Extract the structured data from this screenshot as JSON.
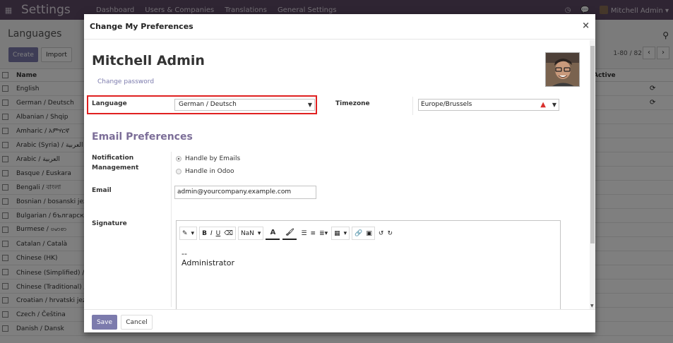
{
  "app": {
    "brand": "Settings",
    "nav": [
      "Dashboard",
      "Users & Companies",
      "Translations",
      "General Settings"
    ],
    "user_name": "Mitchell Admin"
  },
  "control_panel": {
    "breadcrumb": "Languages",
    "create_label": "Create",
    "import_label": "Import",
    "pager": "1-80 / 82"
  },
  "list": {
    "name_header": "Name",
    "active_header": "Active",
    "rows": [
      "English",
      "German / Deutsch",
      "Albanian / Shqip",
      "Amharic / አምሃርኛ",
      "Arabic (Syria) / العربية",
      "Arabic / العربية",
      "Basque / Euskara",
      "Bengali / বাংলা",
      "Bosnian / bosanski jezik",
      "Bulgarian / български",
      "Burmese / ဗမာစာ",
      "Catalan / Català",
      "Chinese (HK)",
      "Chinese (Simplified) / 简体中文",
      "Chinese (Traditional) / 正體字",
      "Croatian / hrvatski jezik",
      "Czech / Čeština",
      "Danish / Dansk"
    ]
  },
  "modal": {
    "title": "Change My Preferences",
    "close_label": "×",
    "user_name": "Mitchell Admin",
    "change_password": "Change password",
    "language_label": "Language",
    "language_value": "German / Deutsch",
    "timezone_label": "Timezone",
    "timezone_value": "Europe/Brussels",
    "email_prefs_title": "Email Preferences",
    "notification_label_1": "Notification",
    "notification_label_2": "Management",
    "notification_options": [
      "Handle by Emails",
      "Handle in Odoo"
    ],
    "notification_selected": "Handle by Emails",
    "email_label": "Email",
    "email_value": "admin@yourcompany.example.com",
    "signature_label": "Signature",
    "signature_line1": "--",
    "signature_line2": "Administrator",
    "font_size_label": "NaN",
    "save_label": "Save",
    "cancel_label": "Cancel"
  },
  "colors": {
    "topbar": "#5f4b67",
    "primary": "#7c7bad",
    "highlight_border": "#e02020",
    "section_title": "#7c6e98"
  },
  "icons": [
    "apps-grid-icon",
    "search-icon",
    "chevron-left-icon",
    "chevron-right-icon",
    "sync-icon",
    "close-icon",
    "warning-icon",
    "caret-down-icon",
    "magic-wand-icon",
    "bold-icon",
    "italic-icon",
    "underline-icon",
    "eraser-icon",
    "font-color-icon",
    "brush-icon",
    "unordered-list-icon",
    "ordered-list-icon",
    "align-icon",
    "table-icon",
    "link-icon",
    "picture-icon",
    "undo-icon",
    "redo-icon"
  ]
}
